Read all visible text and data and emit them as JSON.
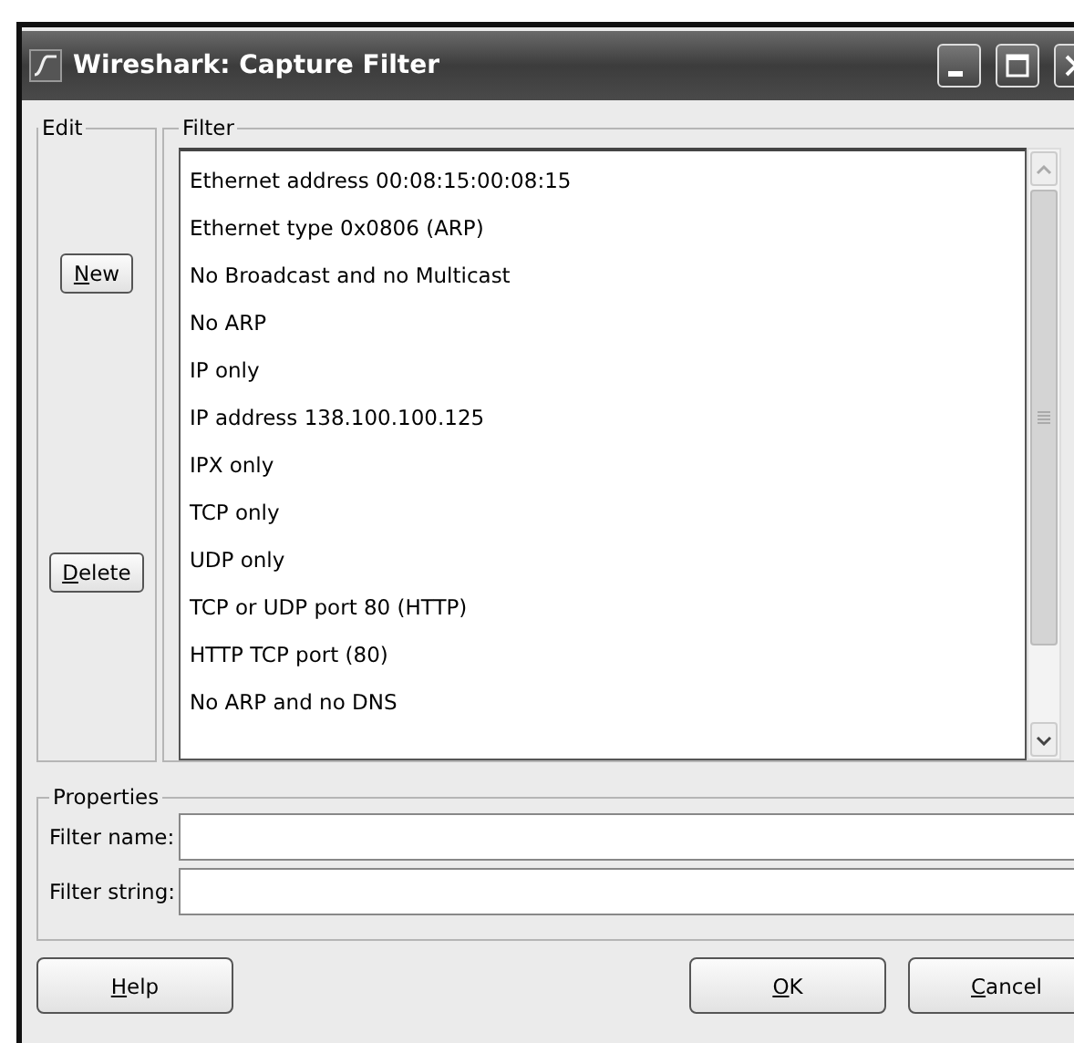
{
  "window": {
    "title": "Wireshark: Capture Filter"
  },
  "edit_group": {
    "legend": "Edit",
    "buttons": [
      "New",
      "Delete"
    ]
  },
  "filter_group": {
    "legend": "Filter",
    "items": [
      {
        "label": "Ethernet address 00:08:15:00:08:15",
        "selected": false
      },
      {
        "label": "Ethernet type 0x0806 (ARP)",
        "selected": false
      },
      {
        "label": "No Broadcast and no Multicast",
        "selected": false
      },
      {
        "label": "No ARP",
        "selected": false
      },
      {
        "label": "IP only",
        "selected": false
      },
      {
        "label": "IP address 138.100.100.125",
        "selected": false
      },
      {
        "label": "IPX only",
        "selected": false
      },
      {
        "label": "TCP only",
        "selected": false
      },
      {
        "label": "UDP only",
        "selected": false
      },
      {
        "label": "TCP or UDP port 80 (HTTP)",
        "selected": false
      },
      {
        "label": "HTTP TCP port (80)",
        "selected": false
      },
      {
        "label": "No ARP and no DNS",
        "selected": false
      }
    ]
  },
  "properties": {
    "legend": "Properties",
    "fields": [
      {
        "label": "Filter name:"
      },
      {
        "label": "Filter string:"
      }
    ]
  },
  "buttons": [
    "Help",
    "OK",
    "Cancel"
  ]
}
